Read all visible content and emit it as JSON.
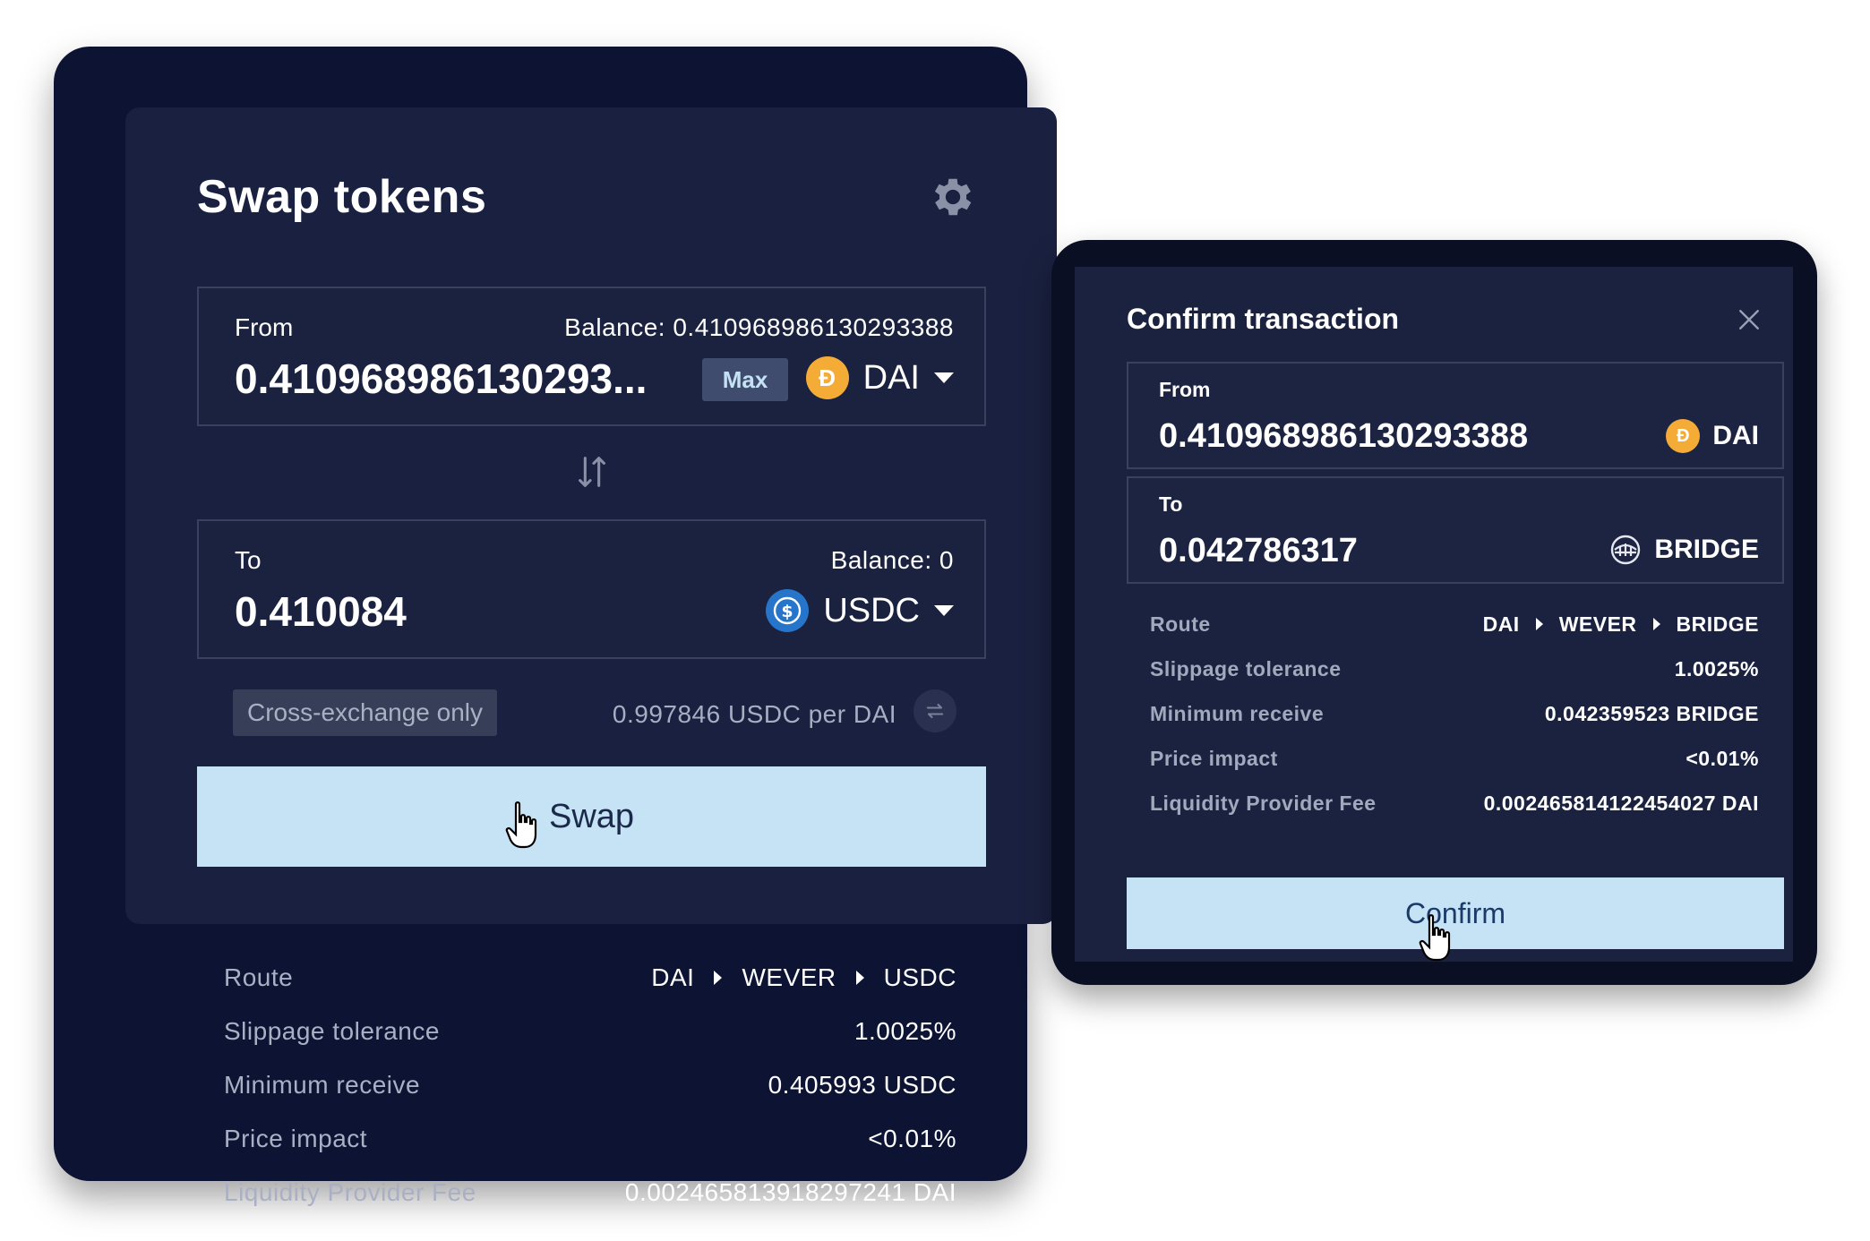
{
  "swap": {
    "title": "Swap tokens",
    "from": {
      "label": "From",
      "balance": "Balance: 0.410968986130293388",
      "amount": "0.410968986130293...",
      "max_label": "Max",
      "token": "DAI"
    },
    "to": {
      "label": "To",
      "balance": "Balance: 0",
      "amount": "0.410084",
      "token": "USDC"
    },
    "cross_exchange_label": "Cross-exchange only",
    "rate": "0.997846 USDC per DAI",
    "swap_button": "Swap",
    "details": {
      "route_label": "Route",
      "route": [
        "DAI",
        "WEVER",
        "USDC"
      ],
      "slippage_label": "Slippage tolerance",
      "slippage_value": "1.0025%",
      "min_receive_label": "Minimum receive",
      "min_receive_value": "0.405993 USDC",
      "price_impact_label": "Price impact",
      "price_impact_value": "<0.01%",
      "lp_fee_label": "Liquidity Provider Fee",
      "lp_fee_value": "0.002465813918297241 DAI"
    }
  },
  "confirm": {
    "title": "Confirm transaction",
    "from": {
      "label": "From",
      "amount": "0.410968986130293388",
      "token": "DAI"
    },
    "to": {
      "label": "To",
      "amount": "0.042786317",
      "token": "BRIDGE"
    },
    "details": {
      "route_label": "Route",
      "route": [
        "DAI",
        "WEVER",
        "BRIDGE"
      ],
      "slippage_label": "Slippage tolerance",
      "slippage_value": "1.0025%",
      "min_receive_label": "Minimum receive",
      "min_receive_value": "0.042359523 BRIDGE",
      "price_impact_label": "Price impact",
      "price_impact_value": "<0.01%",
      "lp_fee_label": "Liquidity Provider Fee",
      "lp_fee_value": "0.002465814122454027 DAI"
    },
    "confirm_button": "Confirm"
  },
  "icons": {
    "settings": "gear-icon",
    "switch": "swap-arrows-icon",
    "refresh": "refresh-icon",
    "close": "close-icon",
    "cursor": "hand-pointer-icon",
    "dai": "dai-token-icon",
    "usdc": "usdc-token-icon",
    "bridge": "bridge-token-icon"
  },
  "colors": {
    "card_outer": "#0d1433",
    "card_inner": "#1a2140",
    "button": "#c5e3f5",
    "dai": "#f5ac37",
    "usdc": "#2775ca"
  }
}
